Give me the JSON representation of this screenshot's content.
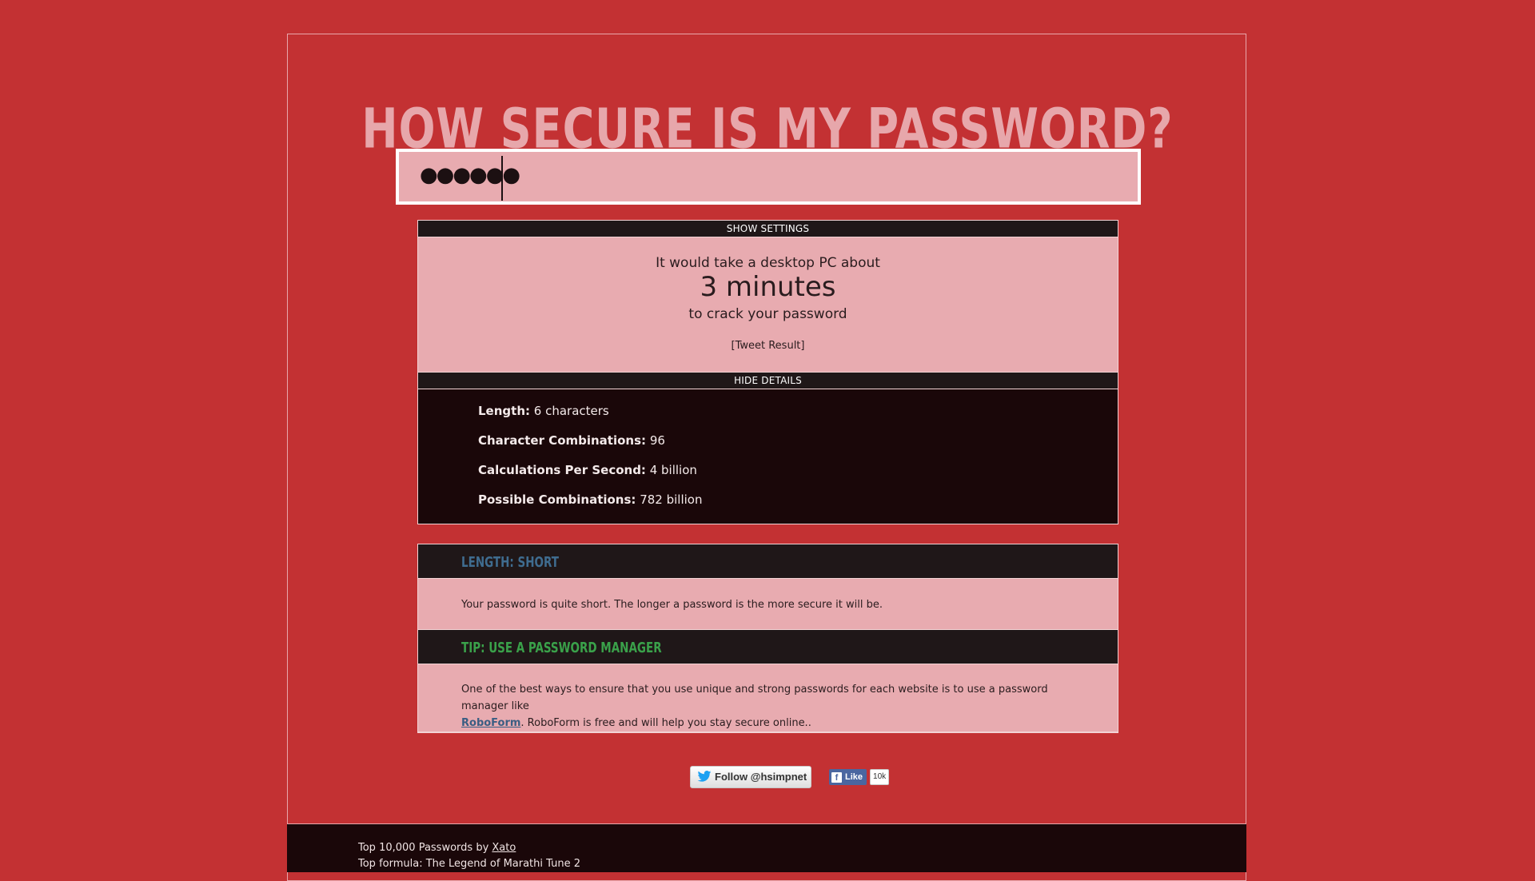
{
  "header": {
    "title": "HOW SECURE IS MY PASSWORD?"
  },
  "password": {
    "masked_value": "●●●●●●"
  },
  "settings_bar": {
    "label": "SHOW SETTINGS"
  },
  "result": {
    "pre": "It would take a desktop PC about",
    "time": "3 minutes",
    "post": "to crack your password",
    "tweet": "[Tweet Result]"
  },
  "details_bar": {
    "label": "HIDE DETAILS"
  },
  "details": {
    "rows": [
      {
        "label": "Length:",
        "value": "6 characters"
      },
      {
        "label": "Character Combinations:",
        "value": "96"
      },
      {
        "label": "Calculations Per Second:",
        "value": "4 billion"
      },
      {
        "label": "Possible Combinations:",
        "value": "782 billion"
      }
    ]
  },
  "checks": [
    {
      "heading": "LENGTH: SHORT",
      "color": "#3f6c8f",
      "body": "Your password is quite short. The longer a password is the more secure it will be."
    },
    {
      "heading": "TIP: USE A PASSWORD MANAGER",
      "color": "#3aa14a",
      "body_pre": "One of the best ways to ensure that you use unique and strong passwords for each website is to use a password manager like",
      "link": "RoboForm",
      "body_post": ". RoboForm is free and will help you stay secure online.."
    }
  ],
  "social": {
    "twitter": "Follow @hsimpnet",
    "fb_like": "Like",
    "fb_count": "10k"
  },
  "footer": {
    "line1_pre": "Top 10,000 Passwords by",
    "line1_link": "Xato",
    "line2": "Top formula: The Legend of Marathi Tune 2"
  },
  "colors": {
    "background": "#c33133",
    "title": "#e7a7ab",
    "panel": "#e8abb0",
    "dark": "#1a0709"
  }
}
